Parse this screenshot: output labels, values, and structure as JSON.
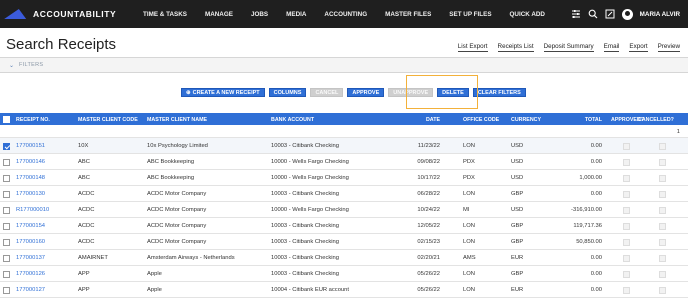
{
  "app": {
    "logo_text": "ACCOUNTABILITY",
    "user_name": "MARIA ALVIR"
  },
  "nav": [
    "TIME & TASKS",
    "MANAGE",
    "JOBS",
    "MEDIA",
    "ACCOUNTING",
    "MASTER FILES",
    "SET UP FILES",
    "QUICK ADD"
  ],
  "page": {
    "title": "Search Receipts"
  },
  "actions": [
    "List Export",
    "Receipts List",
    "Deposit Summary",
    "Email",
    "Export",
    "Preview"
  ],
  "filters": {
    "label": "FILTERS"
  },
  "toolbar": {
    "create": "CREATE A NEW RECEIPT",
    "columns": "COLUMNS",
    "cancel": "CANCEL",
    "approve": "APPROVE",
    "unapprove": "UNAPPROVE",
    "delete": "DELETE",
    "clear_filters": "CLEAR FILTERS"
  },
  "table": {
    "columns": [
      "RECEIPT NO.",
      "MASTER CLIENT CODE",
      "MASTER CLIENT NAME",
      "BANK ACCOUNT",
      "DATE",
      "OFFICE CODE",
      "CURRENCY",
      "TOTAL",
      "APPROVED?",
      "CANCELLED?"
    ],
    "page_indicator": "1",
    "rows": [
      {
        "receipt": "177000151",
        "code": "10X",
        "name": "10x Psychology Limited",
        "bank": "10003 - Citibank Checking",
        "date": "11/23/22",
        "office": "LON",
        "currency": "USD",
        "total": "0.00",
        "selected": true
      },
      {
        "receipt": "177000146",
        "code": "ABC",
        "name": "ABC Bookkeeping",
        "bank": "10000 - Wells Fargo Checking",
        "date": "09/08/22",
        "office": "PDX",
        "currency": "USD",
        "total": "0.00",
        "selected": false
      },
      {
        "receipt": "177000148",
        "code": "ABC",
        "name": "ABC Bookkeeping",
        "bank": "10000 - Wells Fargo Checking",
        "date": "10/17/22",
        "office": "PDX",
        "currency": "USD",
        "total": "1,000.00",
        "selected": false
      },
      {
        "receipt": "177000130",
        "code": "ACDC",
        "name": "ACDC Motor Company",
        "bank": "10003 - Citibank Checking",
        "date": "06/28/22",
        "office": "LON",
        "currency": "GBP",
        "total": "0.00",
        "selected": false
      },
      {
        "receipt": "R177000010",
        "code": "ACDC",
        "name": "ACDC Motor Company",
        "bank": "10000 - Wells Fargo Checking",
        "date": "10/24/22",
        "office": "MI",
        "currency": "USD",
        "total": "-316,910.00",
        "selected": false
      },
      {
        "receipt": "177000154",
        "code": "ACDC",
        "name": "ACDC Motor Company",
        "bank": "10003 - Citibank Checking",
        "date": "12/05/22",
        "office": "LON",
        "currency": "GBP",
        "total": "119,717.36",
        "selected": false
      },
      {
        "receipt": "177000160",
        "code": "ACDC",
        "name": "ACDC Motor Company",
        "bank": "10003 - Citibank Checking",
        "date": "02/15/23",
        "office": "LON",
        "currency": "GBP",
        "total": "50,850.00",
        "selected": false
      },
      {
        "receipt": "177000137",
        "code": "AMAIRNET",
        "name": "Amsterdam Airways - Netherlands",
        "bank": "10003 - Citibank Checking",
        "date": "02/20/21",
        "office": "AMS",
        "currency": "EUR",
        "total": "0.00",
        "selected": false
      },
      {
        "receipt": "177000126",
        "code": "APP",
        "name": "Apple",
        "bank": "10003 - Citibank Checking",
        "date": "05/26/22",
        "office": "LON",
        "currency": "GBP",
        "total": "0.00",
        "selected": false
      },
      {
        "receipt": "177000127",
        "code": "APP",
        "name": "Apple",
        "bank": "10004 - Citibank EUR account",
        "date": "05/26/22",
        "office": "LON",
        "currency": "EUR",
        "total": "0.00",
        "selected": false
      }
    ]
  },
  "colors": {
    "nav_bg": "#1f1f1f",
    "accent": "#2f6fd6",
    "highlight": "#f3b13a"
  }
}
